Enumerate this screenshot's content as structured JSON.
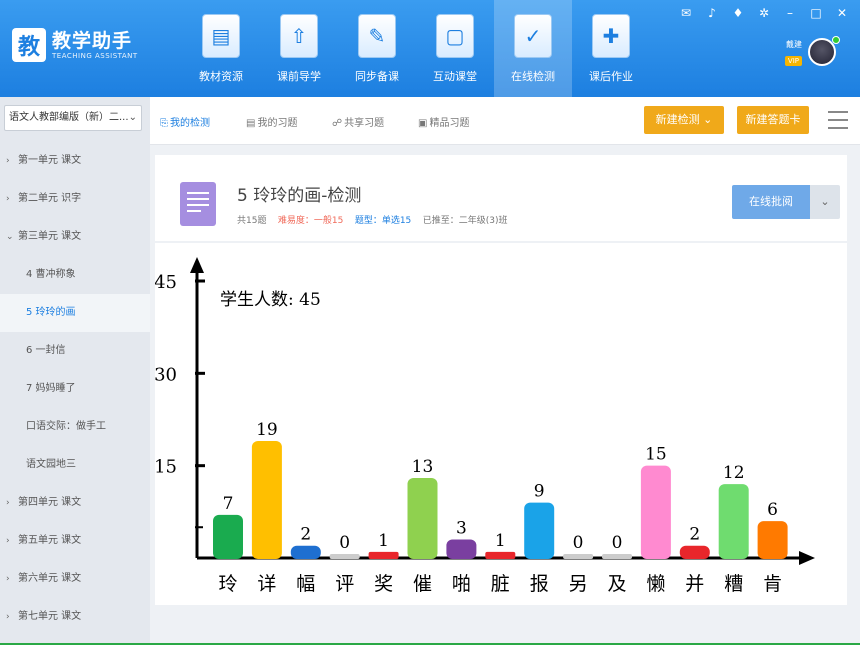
{
  "app": {
    "logo_char": "教",
    "title": "教学助手",
    "subtitle": "TEACHING ASSISTANT"
  },
  "nav": [
    {
      "label": "教材资源",
      "icon": "textbook-resource-icon",
      "glyph": "▤"
    },
    {
      "label": "课前导学",
      "icon": "upload-arrow-icon",
      "glyph": "⇧"
    },
    {
      "label": "同步备课",
      "icon": "pen-document-icon",
      "glyph": "✎"
    },
    {
      "label": "互动课堂",
      "icon": "tablet-icon",
      "glyph": "▢"
    },
    {
      "label": "在线检测",
      "icon": "clipboard-check-icon",
      "glyph": "✓",
      "active": true
    },
    {
      "label": "课后作业",
      "icon": "homework-icon",
      "glyph": "✚"
    }
  ],
  "user": {
    "name": "戴建",
    "tag": "VIP"
  },
  "sidebar": {
    "book": "语文人教部编版（新）二...",
    "items": [
      {
        "label": "第一单元 课文",
        "type": "unit",
        "arrow": "›"
      },
      {
        "label": "第二单元 识字",
        "type": "unit",
        "arrow": "›"
      },
      {
        "label": "第三单元 课文",
        "type": "unit",
        "arrow": "⌄"
      },
      {
        "label": "4 曹冲称象",
        "type": "lesson"
      },
      {
        "label": "5 玲玲的画",
        "type": "lesson",
        "active": true
      },
      {
        "label": "6 一封信",
        "type": "lesson"
      },
      {
        "label": "7 妈妈睡了",
        "type": "lesson"
      },
      {
        "label": "口语交际：做手工",
        "type": "lesson"
      },
      {
        "label": "语文园地三",
        "type": "lesson"
      },
      {
        "label": "第四单元 课文",
        "type": "unit",
        "arrow": "›"
      },
      {
        "label": "第五单元 课文",
        "type": "unit",
        "arrow": "›"
      },
      {
        "label": "第六单元 课文",
        "type": "unit",
        "arrow": "›"
      },
      {
        "label": "第七单元 课文",
        "type": "unit",
        "arrow": "›"
      }
    ]
  },
  "subtabs": [
    {
      "label": "我的检测",
      "active": true
    },
    {
      "label": "我的习题"
    },
    {
      "label": "共享习题"
    },
    {
      "label": "精品习题"
    }
  ],
  "actions": {
    "new_test": "新建检测",
    "new_card": "新建答题卡"
  },
  "test": {
    "title": "5 玲玲的画-检测",
    "count": "共15题",
    "difficulty": "难易度：一般15",
    "qtype": "题型：单选15",
    "pushed": "已推至：二年级(3)班",
    "review_btn": "在线批阅"
  },
  "chart_data": {
    "type": "bar",
    "annotation": "学生人数: 45",
    "categories": [
      "玲",
      "详",
      "幅",
      "评",
      "奖",
      "催",
      "啪",
      "脏",
      "报",
      "另",
      "及",
      "懒",
      "并",
      "糟",
      "肯"
    ],
    "values": [
      7,
      19,
      2,
      0,
      1,
      13,
      3,
      1,
      9,
      0,
      0,
      15,
      2,
      12,
      6
    ],
    "colors": [
      "#1aab4f",
      "#ffbf00",
      "#1e6fd0",
      "#cccccc",
      "#e8262b",
      "#8fd14f",
      "#7a3fa0",
      "#e8262b",
      "#1aa3e8",
      "#cccccc",
      "#cccccc",
      "#ff8ad0",
      "#e8262b",
      "#6fdc6f",
      "#ff7a00"
    ],
    "yticks": [
      15,
      30,
      45
    ],
    "ylim": [
      0,
      45
    ],
    "grid": false
  }
}
